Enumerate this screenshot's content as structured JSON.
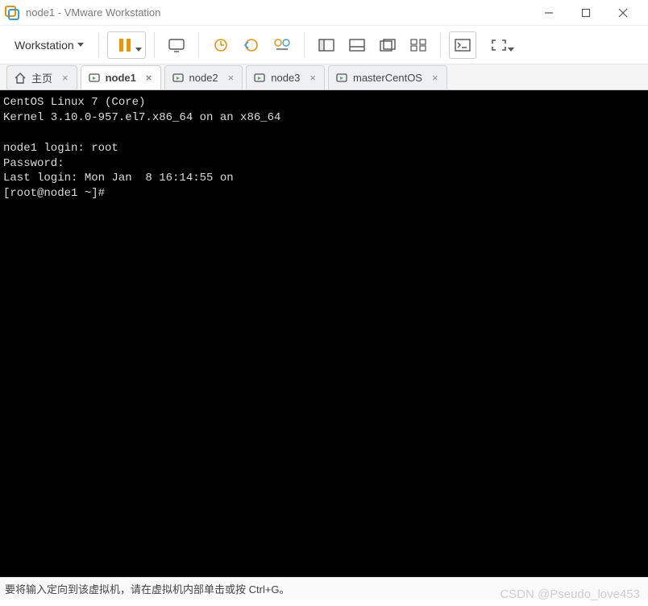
{
  "window": {
    "title": "node1 - VMware Workstation"
  },
  "menu": {
    "workstation": "Workstation"
  },
  "tabs": [
    {
      "label": "主页",
      "kind": "home",
      "active": false
    },
    {
      "label": "node1",
      "kind": "vm",
      "active": true
    },
    {
      "label": "node2",
      "kind": "vm",
      "active": false
    },
    {
      "label": "node3",
      "kind": "vm",
      "active": false
    },
    {
      "label": "masterCentOS",
      "kind": "vm",
      "active": false
    }
  ],
  "terminal": {
    "lines": [
      "CentOS Linux 7 (Core)",
      "Kernel 3.10.0-957.el7.x86_64 on an x86_64",
      "",
      "node1 login: root",
      "Password:",
      "Last login: Mon Jan  8 16:14:55 on",
      "[root@node1 ~]# "
    ]
  },
  "statusbar": {
    "hint": "要将输入定向到该虚拟机，请在虚拟机内部单击或按 Ctrl+G。"
  },
  "watermark": "CSDN @Pseudo_love453"
}
